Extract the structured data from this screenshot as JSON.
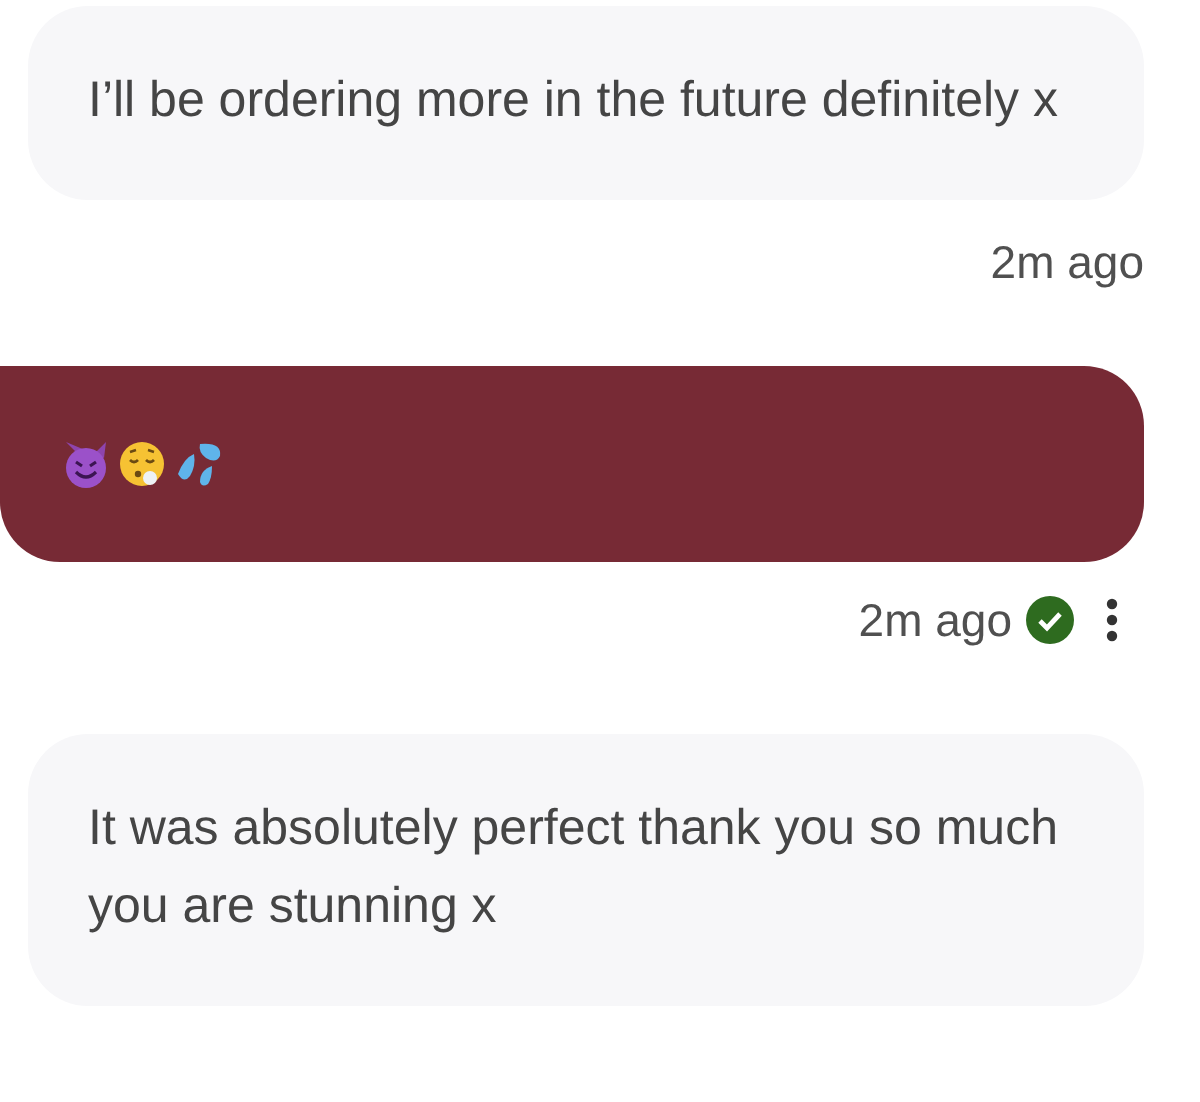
{
  "messages": [
    {
      "kind": "incoming",
      "text": "I’ll be ordering more in the future definitely x",
      "time": "2m ago"
    },
    {
      "kind": "outgoing_emoji",
      "time": "2m ago",
      "read": true
    },
    {
      "kind": "incoming",
      "text": "It was absolutely perfect thank you so much you are stunning x"
    }
  ]
}
